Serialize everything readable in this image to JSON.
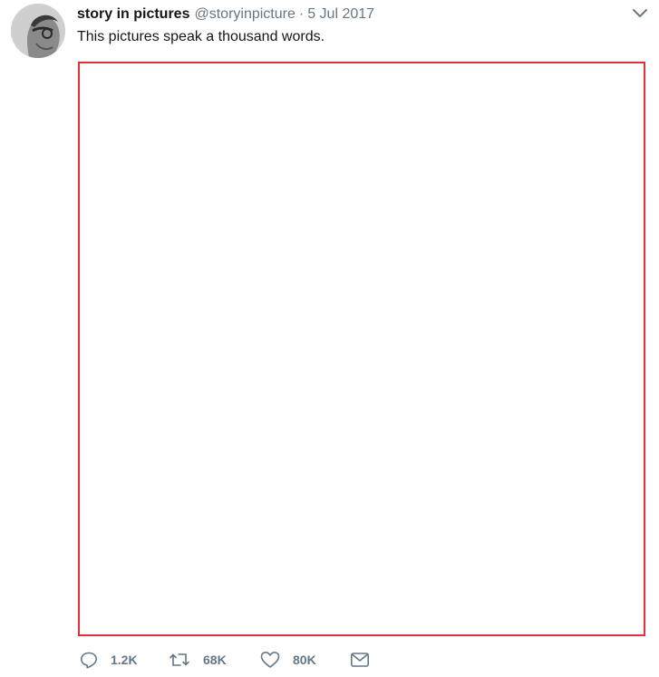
{
  "tweet": {
    "author_name": "story in pictures",
    "handle": "@storyinpicture",
    "separator": "·",
    "date": "5 Jul 2017",
    "text": "This pictures speak a thousand words."
  },
  "icons": {
    "avatar": "profile-photo",
    "caret": "chevron-down-icon",
    "reply": "reply-icon",
    "retweet": "retweet-icon",
    "like": "heart-icon",
    "dm": "envelope-icon"
  },
  "actions": {
    "reply_count": "1.2K",
    "retweet_count": "68K",
    "like_count": "80K"
  },
  "colors": {
    "text": "#14171a",
    "secondary": "#657786",
    "media_border": "#e0303c"
  }
}
